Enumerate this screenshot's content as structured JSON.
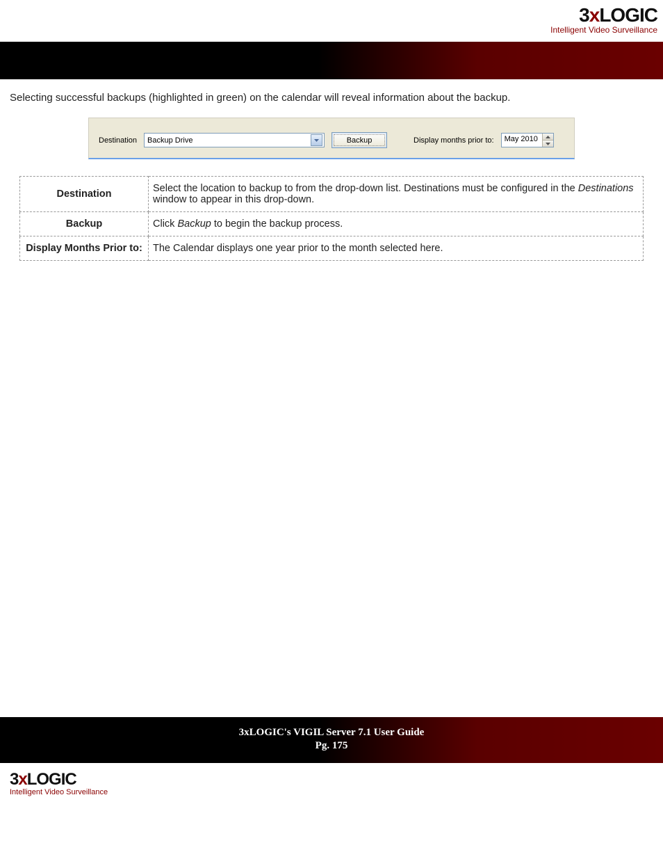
{
  "brand": {
    "part1": "3",
    "x": "x",
    "part2": "LOGIC",
    "tagline": "Intelligent Video Surveillance"
  },
  "intro": "Selecting successful backups (highlighted in green) on the calendar will reveal information about the backup.",
  "panel": {
    "destination_label": "Destination",
    "destination_value": "Backup Drive",
    "backup_button": "Backup",
    "display_months_label": "Display months prior to:",
    "month_value": "May 2010"
  },
  "table": {
    "rows": [
      {
        "header": "Destination",
        "body_pre": "Select the location to backup to from the drop-down list.  Destinations must be configured in the ",
        "body_em": "Destinations",
        "body_post": " window to appear in this drop-down."
      },
      {
        "header": "Backup",
        "body_pre": "Click ",
        "body_em": "Backup",
        "body_post": " to begin the backup process."
      },
      {
        "header": "Display Months Prior to:",
        "body_pre": "The Calendar displays one year prior to the month selected here.",
        "body_em": "",
        "body_post": ""
      }
    ]
  },
  "footer": {
    "title": "3xLOGIC's VIGIL Server 7.1 User Guide",
    "page": "Pg. 175"
  }
}
